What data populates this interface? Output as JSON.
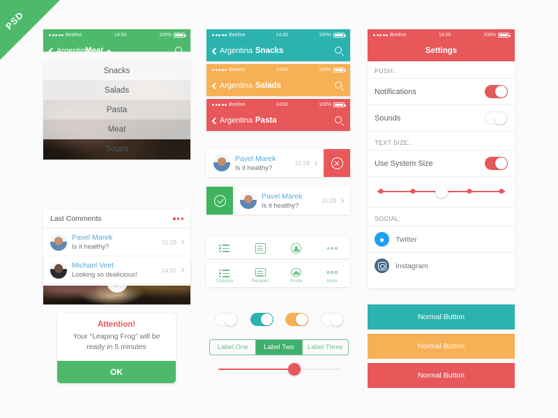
{
  "ribbon": {
    "label": "PSD"
  },
  "statusbar": {
    "carrier": "Beeline",
    "time": "14:00",
    "battery": "100%"
  },
  "colors": {
    "green": "#4cba6a",
    "teal": "#2cb3b0",
    "orange": "#f7b055",
    "red": "#e8575a",
    "link_blue": "#56a9e0"
  },
  "column1": {
    "navbar": {
      "back": "Argentina",
      "title": "Meat",
      "search_icon": "search-icon",
      "caret_icon": "caret-up-icon"
    },
    "dropdown": {
      "items": [
        "Snacks",
        "Salads",
        "Pasta",
        "Meat",
        "Soups"
      ]
    },
    "hero": {
      "play_icon": "play-icon"
    },
    "comments": {
      "heading": "Last Comments",
      "more_icon": "more-dots-icon",
      "rows": [
        {
          "name": "Pavel Marek",
          "text": "Is it healthy?",
          "time": "15:29"
        },
        {
          "name": "Michael Veet",
          "text": "Looking so dealicious!",
          "time": "14:01"
        }
      ]
    }
  },
  "column2": {
    "navbars": [
      {
        "back": "Argentina",
        "title": "Snacks",
        "color": "teal"
      },
      {
        "back": "Argentina",
        "title": "Salads",
        "color": "orange"
      },
      {
        "back": "Argentina",
        "title": "Pasta",
        "color": "red"
      }
    ],
    "swipe_rows": [
      {
        "name": "Pavel Marek",
        "text": "Is it healthy?",
        "time": "15:29",
        "action": "delete",
        "action_icon": "close-circle-icon"
      },
      {
        "name": "Pavel Marek",
        "text": "Is it healthy?",
        "time": "15:29",
        "action": "confirm",
        "action_icon": "check-circle-icon"
      }
    ],
    "tabbars": {
      "icons": [
        "list-icon",
        "document-icon",
        "profile-icon",
        "more-icon"
      ],
      "labels": [
        "Cuisines",
        "Recipies",
        "Profile",
        "More"
      ]
    }
  },
  "column3": {
    "navbar": {
      "title": "Settings"
    },
    "sections": [
      {
        "heading": "PUSH:",
        "rows": [
          {
            "label": "Notifications",
            "toggle": "on"
          },
          {
            "label": "Sounds",
            "toggle": "off"
          }
        ]
      },
      {
        "heading": "TEXT SIZE:",
        "rows": [
          {
            "label": "Use System Size",
            "toggle": "on"
          }
        ]
      },
      {
        "heading": "SOCIAL:",
        "rows": [
          {
            "label": "Twitter",
            "icon": "twitter-icon"
          },
          {
            "label": "Instagram",
            "icon": "instagram-icon"
          }
        ]
      }
    ],
    "text_size_slider": {
      "steps": 5,
      "selected_index": 2
    }
  },
  "alert": {
    "title": "Attention!",
    "message": "Your “Leaping Frog” will be ready in 5 minutes",
    "ok_label": "OK"
  },
  "controls": {
    "toggles": [
      {
        "state": "off",
        "color": ""
      },
      {
        "state": "on",
        "color": "teal"
      },
      {
        "state": "on",
        "color": "orange"
      },
      {
        "state": "off",
        "color": ""
      }
    ],
    "segmented": {
      "options": [
        "Label One",
        "Label Two",
        "Label Three"
      ],
      "selected_index": 1
    },
    "slider": {
      "value_percent": 62
    }
  },
  "buttons": [
    {
      "label": "Normal Button",
      "color": "teal"
    },
    {
      "label": "Normal Button",
      "color": "orange"
    },
    {
      "label": "Normal Button",
      "color": "red"
    }
  ]
}
